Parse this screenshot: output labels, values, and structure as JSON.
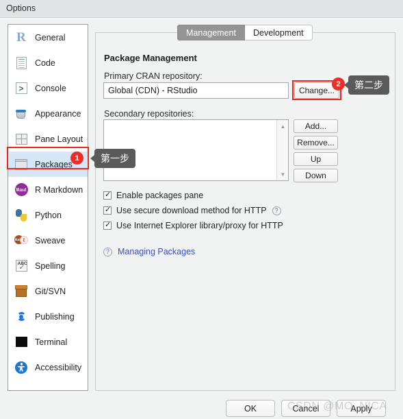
{
  "window": {
    "title": "Options"
  },
  "sidebar": {
    "items": [
      {
        "label": "General",
        "icon": "r-logo-icon",
        "selected": false
      },
      {
        "label": "Code",
        "icon": "code-document-icon",
        "selected": false
      },
      {
        "label": "Console",
        "icon": "console-prompt-icon",
        "selected": false
      },
      {
        "label": "Appearance",
        "icon": "paint-bucket-icon",
        "selected": false
      },
      {
        "label": "Pane Layout",
        "icon": "pane-grid-icon",
        "selected": false
      },
      {
        "label": "Packages",
        "icon": "package-box-icon",
        "selected": true
      },
      {
        "label": "R Markdown",
        "icon": "rmd-circle-icon",
        "selected": false
      },
      {
        "label": "Python",
        "icon": "python-logo-icon",
        "selected": false
      },
      {
        "label": "Sweave",
        "icon": "sweave-pdf-icon",
        "selected": false
      },
      {
        "label": "Spelling",
        "icon": "spellcheck-icon",
        "selected": false
      },
      {
        "label": "Git/SVN",
        "icon": "git-box-icon",
        "selected": false
      },
      {
        "label": "Publishing",
        "icon": "publishing-icon",
        "selected": false
      },
      {
        "label": "Terminal",
        "icon": "terminal-icon",
        "selected": false
      },
      {
        "label": "Accessibility",
        "icon": "accessibility-icon",
        "selected": false
      }
    ],
    "icon_text": {
      "general": "R",
      "console": ">",
      "rmd": "Rmd",
      "sweave_left": "Rmd",
      "sweave_right": "ℓ",
      "spelling_abc": "ABC",
      "spelling_check": "✓"
    }
  },
  "tabs": [
    {
      "label": "Management",
      "active": true
    },
    {
      "label": "Development",
      "active": false
    }
  ],
  "main": {
    "section_title": "Package Management",
    "cran_label": "Primary CRAN repository:",
    "cran_value": "Global (CDN) - RStudio",
    "change_button": "Change...",
    "secondary_label": "Secondary repositories:",
    "secondary_items": [],
    "list_buttons": [
      "Add...",
      "Remove...",
      "Up",
      "Down"
    ],
    "scroll_up_icon": "▲",
    "scroll_down_icon": "▼",
    "checkboxes": [
      {
        "label": "Enable packages pane",
        "checked": true,
        "help": false
      },
      {
        "label": "Use secure download method for HTTP",
        "checked": true,
        "help": true
      },
      {
        "label": "Use Internet Explorer library/proxy for HTTP",
        "checked": true,
        "help": false
      }
    ],
    "help_glyph": "?",
    "link_label": "Managing Packages"
  },
  "footer": {
    "ok": "OK",
    "cancel": "Cancel",
    "apply": "Apply"
  },
  "annotations": {
    "step1": {
      "badge": "1",
      "text": "第一步"
    },
    "step2": {
      "badge": "2",
      "text": "第二步"
    },
    "highlight_color": "#ef2518",
    "badge_color": "#ec2d28",
    "callout_color": "#5a5a5a"
  },
  "watermark": {
    "text": "CSDN @MO_NICA"
  }
}
